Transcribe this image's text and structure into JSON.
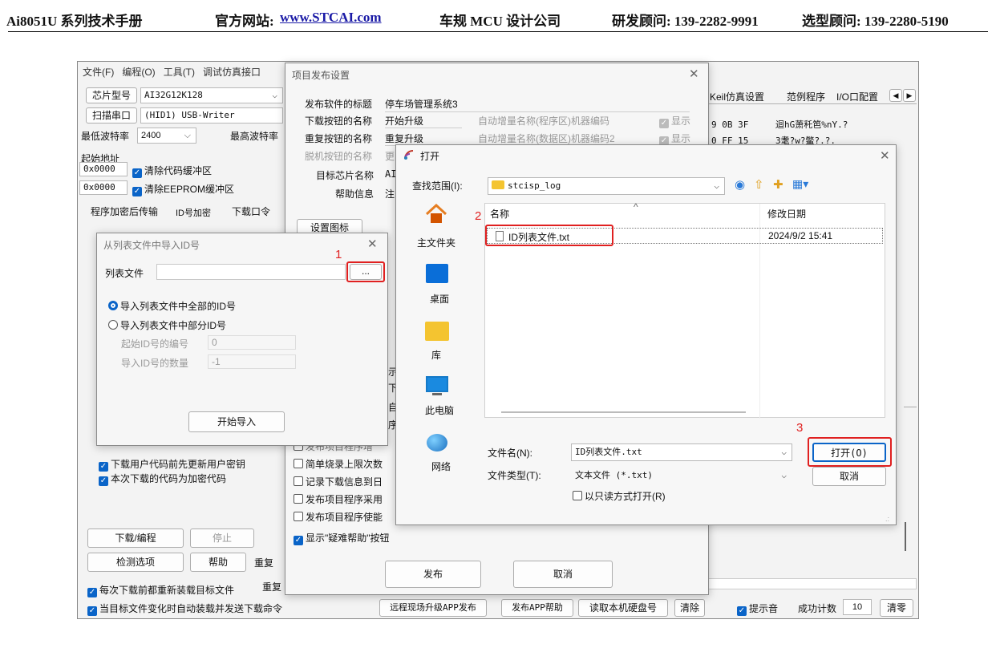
{
  "page_header": {
    "manual": "Ai8051U 系列技术手册",
    "site_label": "官方网站:",
    "site_url": "www.STCAI.com",
    "company": "车规 MCU 设计公司",
    "rd_contact": "研发顾问: 139-2282-9991",
    "sales_contact": "选型顾问: 139-2280-5190"
  },
  "main_window": {
    "menu": [
      "文件(F)",
      "编程(O)",
      "工具(T)",
      "调试仿真接口"
    ],
    "chip_label": "芯片型号",
    "chip_value": "AI32G12K128",
    "scan_port": "扫描串口",
    "port_value": "(HID1) USB-Writer",
    "min_baud_label": "最低波特率",
    "min_baud_value": "2400",
    "max_baud_label": "最高波特率",
    "start_addr_label": "起始地址",
    "addr1": "0x0000",
    "clear_code": "清除代码缓冲区",
    "addr2": "0x0000",
    "clear_eeprom": "清除EEPROM缓冲区",
    "tabs": [
      "程序加密后传输",
      "ID号加密",
      "下载口令"
    ],
    "right_tabs": [
      "Keil仿真设置",
      "范例程序",
      "I/O口配置"
    ],
    "hex_line1": "9 0B 3F",
    "hex_text1": "迴hG萧秅笆%nY.?",
    "hex_line2": "0 FF 15",
    "hex_text2": "3耄?w?鳖?.?.",
    "chk_update_key": "下载用户代码前先更新用户密钥",
    "chk_encrypted": "本次下载的代码为加密代码",
    "btn_download": "下载/编程",
    "btn_stop": "停止",
    "btn_detect": "检测选项",
    "btn_help": "帮助",
    "label_repeat1": "重复",
    "label_repeat2": "重复",
    "chk_reload": "每次下载前都重新装载目标文件",
    "chk_auto": "当目标文件变化时自动装载并发送下载命令",
    "btn_remote": "远程现场升级APP发布",
    "btn_app_help": "发布APP帮助",
    "btn_read_disk": "读取本机硬盘号",
    "btn_clear": "清除",
    "chk_sound": "提示音",
    "success_label": "成功计数",
    "success_value": "10",
    "btn_zero": "清零"
  },
  "publish_dialog": {
    "title": "项目发布设置",
    "title_label": "发布软件的标题",
    "title_value": "停车场管理系统3",
    "download_btn_label": "下载按钮的名称",
    "download_btn_value": "开始升级",
    "auto_inc_1": "自动增量名称(程序区)机器编码",
    "show": "显示",
    "repeat_btn_label": "重复按钮的名称",
    "repeat_btn_value": "重复升级",
    "auto_inc_2": "自动增量名称(数据区)机器编码2",
    "offline_btn_label": "脱机按钮的名称",
    "offline_btn_value": "更",
    "target_chip_label": "目标芯片名称",
    "target_chip_value": "AI",
    "help_label": "帮助信息",
    "help_value": "注",
    "set_icon": "设置图标",
    "partial_chars": [
      "示",
      "下",
      "自",
      "序"
    ],
    "options": [
      "发布项目程序增",
      "简单烧录上限次数",
      "记录下载信息到日",
      "发布项目程序采用",
      "发布项目程序使能"
    ],
    "opt_show_help": "显示\"疑难帮助\"按钮",
    "btn_publish": "发布",
    "btn_cancel": "取消"
  },
  "import_dialog": {
    "title": "从列表文件中导入ID号",
    "list_file_label": "列表文件",
    "browse": "...",
    "radio_all": "导入列表文件中全部的ID号",
    "radio_part": "导入列表文件中部分ID号",
    "start_id_label": "起始ID号的编号",
    "start_id_value": "0",
    "count_label": "导入ID号的数量",
    "count_value": "-1",
    "btn_start": "开始导入"
  },
  "open_dialog": {
    "title": "打开",
    "look_in_label": "查找范围(I):",
    "look_in_value": "stcisp_log",
    "places": [
      "主文件夹",
      "桌面",
      "库",
      "此电脑",
      "网络"
    ],
    "col_name": "名称",
    "col_date": "修改日期",
    "file_name": "ID列表文件.txt",
    "file_date": "2024/9/2 15:41",
    "filename_label": "文件名(N):",
    "filename_value": "ID列表文件.txt",
    "filetype_label": "文件类型(T):",
    "filetype_value": "文本文件 (*.txt)",
    "readonly": "以只读方式打开(R)",
    "btn_open": "打开(O)",
    "btn_cancel": "取消"
  },
  "annotations": [
    "1",
    "2",
    "3"
  ]
}
